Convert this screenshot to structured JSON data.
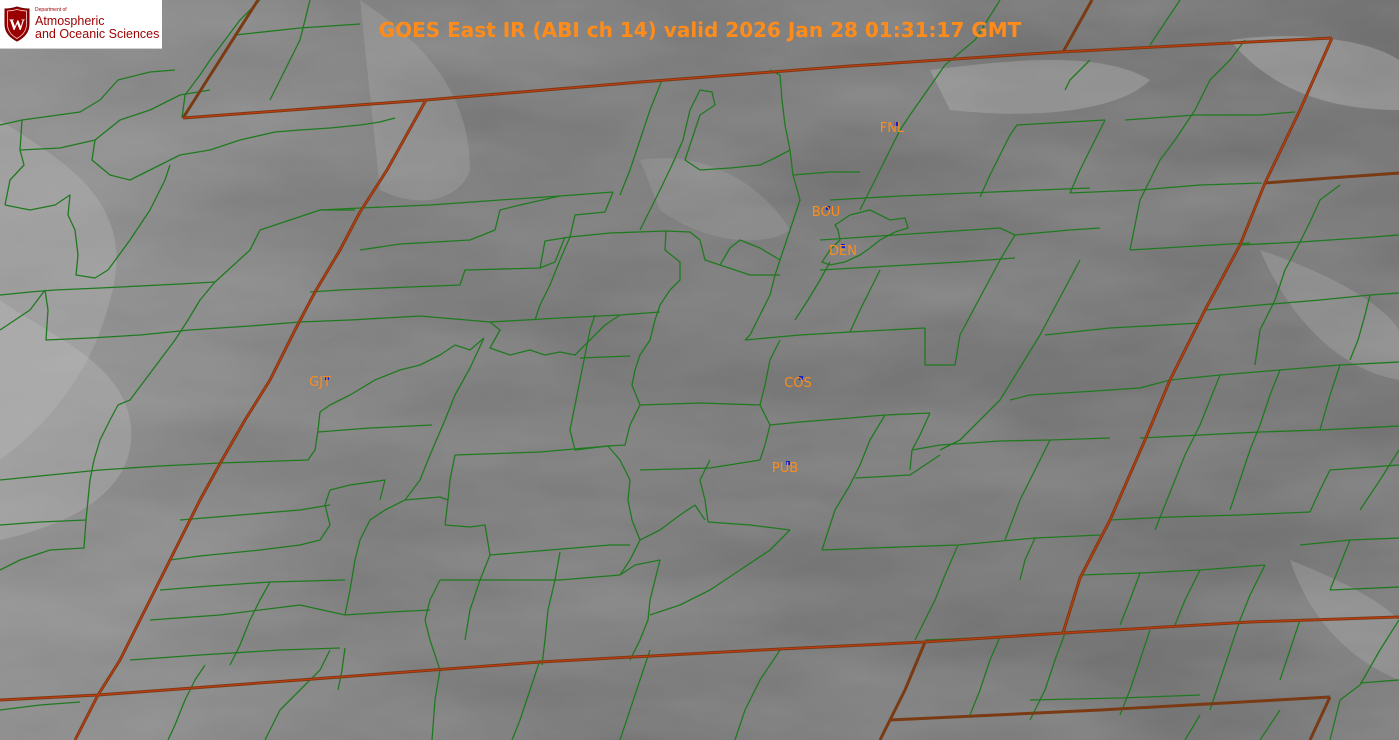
{
  "title": "GOES East IR (ABI ch 14) valid 2026 Jan 28 01:31:17 GMT",
  "logo": {
    "crest_letter": "W",
    "department": "Department of",
    "line1": "Atmospheric",
    "line2": "and Oceanic Sciences"
  },
  "stations": [
    {
      "code": "FNL"
    },
    {
      "code": "BOU"
    },
    {
      "code": "DEN"
    },
    {
      "code": "GJT"
    },
    {
      "code": "COS"
    },
    {
      "code": "PUB"
    }
  ],
  "colors": {
    "title": "#ff8c1a",
    "county_lines": "#1f7a1f",
    "state_lines": "#7a3b14",
    "state_highlight": "#c83a12",
    "station_label": "#ff8c1a",
    "station_marker": "#1020d0",
    "logo_brand": "#9b0000"
  },
  "icons": {
    "logo": "uw-crest-icon",
    "station": "station-marker-icon"
  }
}
